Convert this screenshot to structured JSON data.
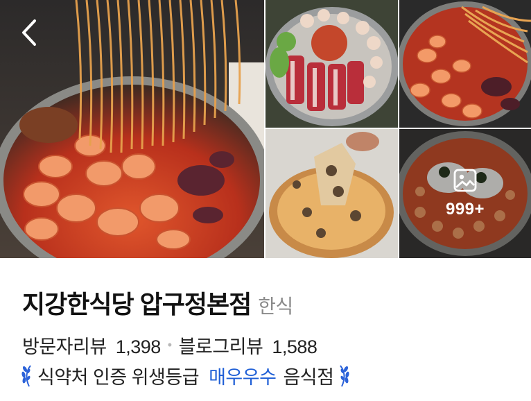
{
  "gallery": {
    "back_icon": "chevron-left-icon",
    "more_icon": "image-icon",
    "more_count": "999+"
  },
  "place": {
    "name": "지강한식당 압구정본점",
    "category": "한식"
  },
  "reviews": {
    "visitor_label": "방문자리뷰",
    "visitor_count": "1,398",
    "separator": "•",
    "blog_label": "블로그리뷰",
    "blog_count": "1,588"
  },
  "hygiene": {
    "prefix": "식약처 인증 위생등급",
    "grade": "매우우수",
    "suffix": "음식점",
    "grade_color": "#1f5fd6",
    "icon": "laurel-icon"
  }
}
